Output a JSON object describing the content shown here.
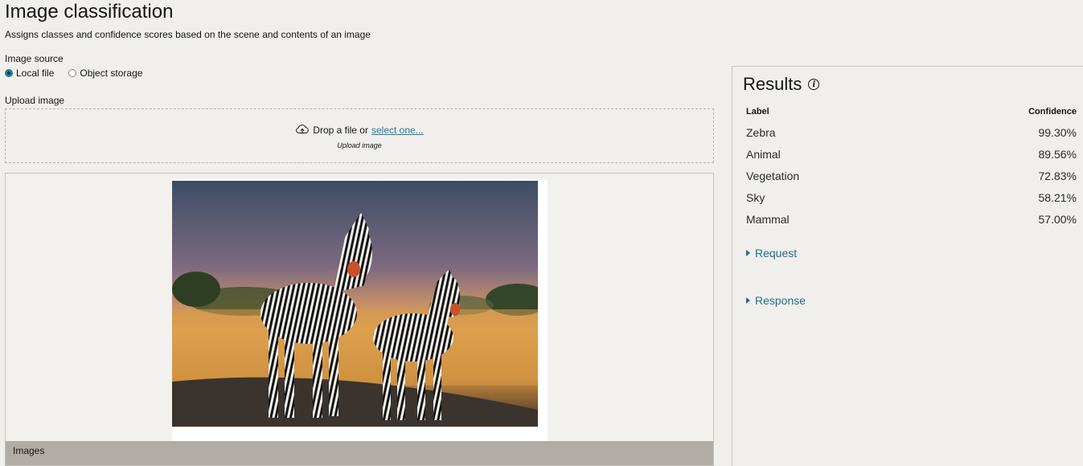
{
  "header": {
    "title": "Image classification",
    "subtitle": "Assigns classes and confidence scores based on the scene and contents of an image"
  },
  "source": {
    "label": "Image source",
    "options": [
      {
        "label": "Local file",
        "selected": true
      },
      {
        "label": "Object storage",
        "selected": false
      }
    ]
  },
  "upload": {
    "label": "Upload image",
    "drop_text": "Drop a file or",
    "select_link": "select one...",
    "hint": "Upload image"
  },
  "preview": {
    "footer_label": "Images"
  },
  "results": {
    "title": "Results",
    "columns": {
      "label": "Label",
      "confidence": "Confidence"
    },
    "rows": [
      {
        "label": "Zebra",
        "confidence": "99.30%"
      },
      {
        "label": "Animal",
        "confidence": "89.56%"
      },
      {
        "label": "Vegetation",
        "confidence": "72.83%"
      },
      {
        "label": "Sky",
        "confidence": "58.21%"
      },
      {
        "label": "Mammal",
        "confidence": "57.00%"
      }
    ],
    "request_label": "Request",
    "response_label": "Response"
  },
  "colors": {
    "accent": "#227e9e",
    "link": "#1f6e8c",
    "background": "#f1efec",
    "footer_bar": "#b2aca6"
  }
}
